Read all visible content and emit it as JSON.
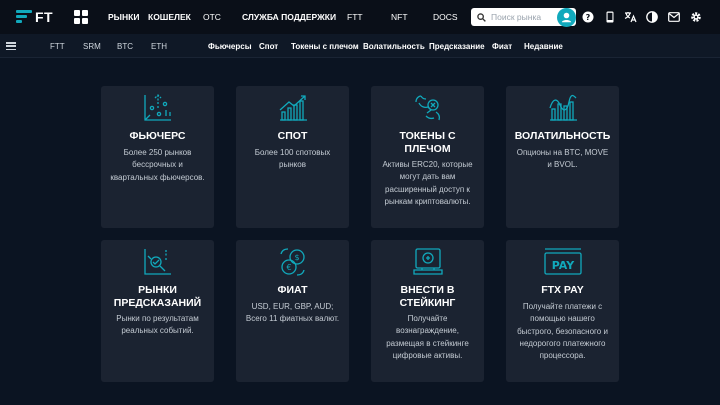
{
  "header": {
    "logo_text": "FT",
    "nav_items": [
      "РЫНКИ",
      "КОШЕЛЕК"
    ],
    "otc": "OTC",
    "support": "СЛУЖБА ПОДДЕРЖКИ",
    "ftt": "FTT",
    "nft": "NFT",
    "docs": "DOCS",
    "search_placeholder": "Поиск рынка"
  },
  "subnav": {
    "coins": [
      "FTT",
      "SRM",
      "BTC",
      "ETH"
    ],
    "links": [
      "Фьючерсы",
      "Спот",
      "Токены с плечом",
      "Волатильность",
      "Предсказание",
      "Фиат",
      "Недавние"
    ]
  },
  "cards": [
    {
      "title": "ФЬЮЧЕРС",
      "desc": "Более 250 рынков бессрочных и квартальных фьючерсов.",
      "icon": "futures-icon"
    },
    {
      "title": "СПОТ",
      "desc": "Более 100 спотовых рынков",
      "icon": "spot-chart-icon"
    },
    {
      "title": "ТОКЕНЫ С ПЛЕЧОМ",
      "desc": "Активы ERC20, которые могут дать вам расширенный доступ к рынкам криптовалюты.",
      "icon": "bull-bear-icon"
    },
    {
      "title": "ВОЛАТИЛЬНОСТЬ",
      "desc": "Опционы на BTC, MOVE и BVOL.",
      "icon": "volatility-icon"
    },
    {
      "title": "РЫНКИ ПРЕДСКАЗАНИЙ",
      "desc": "Рынки по результатам реальных событий.",
      "icon": "prediction-icon"
    },
    {
      "title": "ФИАТ",
      "desc": "USD, EUR, GBP, AUD; Всего 11 фиатных валют.",
      "icon": "fiat-exchange-icon"
    },
    {
      "title": "ВНЕСТИ В СТЕЙКИНГ",
      "desc": "Получайте вознаграждение, размещая в стейкинге цифровые активы.",
      "icon": "staking-icon"
    },
    {
      "title": "FTX PAY",
      "desc": "Получайте платежи с помощью нашего быстрого, безопасного и недорогого платежного процессора.",
      "icon": "ftx-pay-icon"
    }
  ],
  "colors": {
    "accent": "#11a9bc",
    "background": "#0b1422",
    "card": "#1b2331"
  }
}
